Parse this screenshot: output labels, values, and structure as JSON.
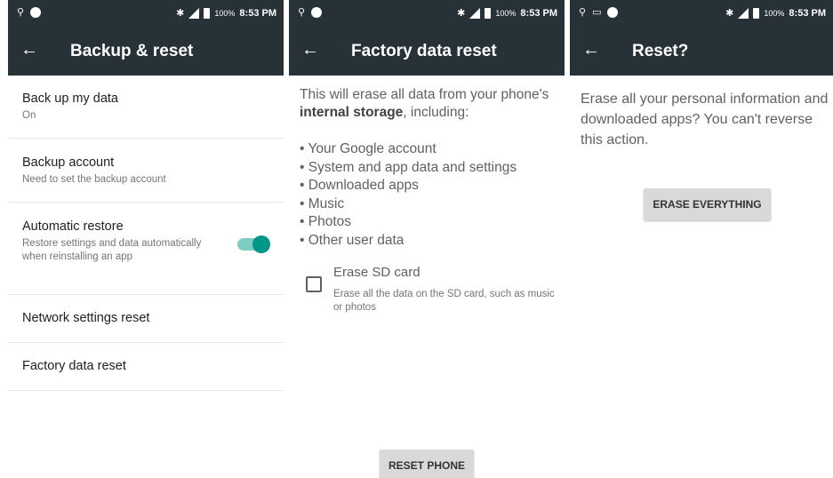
{
  "status": {
    "time": "8:53 PM",
    "battery": "100%"
  },
  "screen1": {
    "title": "Backup & reset",
    "items": [
      {
        "title": "Back up my data",
        "subtitle": "On"
      },
      {
        "title": "Backup account",
        "subtitle": "Need to set the backup account"
      },
      {
        "title": "Automatic restore",
        "subtitle": "Restore settings and data automatically when reinstalling an app",
        "toggle_on": true
      },
      {
        "title": "Network settings reset"
      },
      {
        "title": "Factory data reset"
      }
    ]
  },
  "screen2": {
    "title": "Factory data reset",
    "intro_before": "This will erase all data from your phone's ",
    "intro_bold": "internal storage",
    "intro_after": ", including:",
    "bullets": [
      "Your Google account",
      "System and app data and settings",
      "Downloaded apps",
      "Music",
      "Photos",
      "Other user data"
    ],
    "sd_title": "Erase SD card",
    "sd_subtitle": "Erase all the data on the SD card, such as music or photos",
    "button": "RESET PHONE"
  },
  "screen3": {
    "title": "Reset?",
    "message": "Erase all your personal information and downloaded apps? You can't reverse this action.",
    "button": "ERASE EVERYTHING"
  },
  "icons": [
    "usb-icon",
    "chat-bubble-icon",
    "bluetooth-icon",
    "signal-icon",
    "battery-icon",
    "back-arrow-icon",
    "image-icon"
  ]
}
